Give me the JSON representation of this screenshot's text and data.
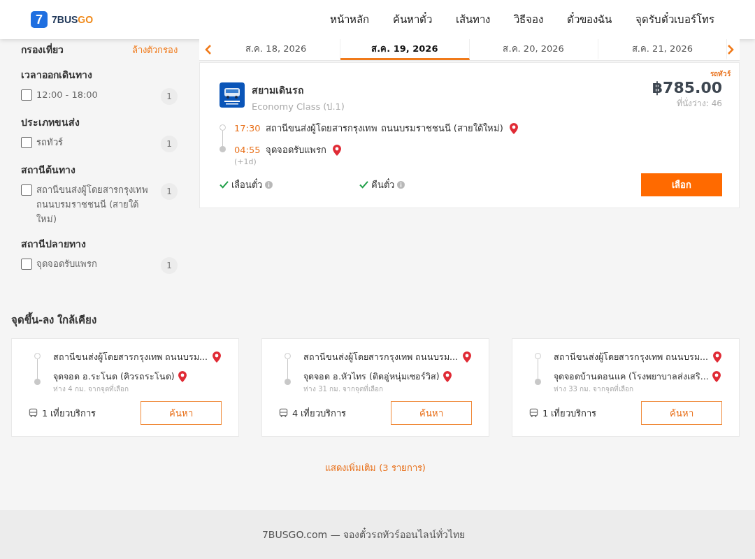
{
  "header": {
    "logo": {
      "mark": "7",
      "brand_dark": "7BUS",
      "brand_accent": "GO"
    },
    "nav": [
      {
        "label": "หน้าหลัก"
      },
      {
        "label": "ค้นหาตั๋ว"
      },
      {
        "label": "เส้นทาง"
      },
      {
        "label": "วิธีจอง"
      },
      {
        "label": "ตั๋วของฉัน"
      },
      {
        "label": "จุดรับตั๋วเบอร์โทร"
      }
    ]
  },
  "filters": {
    "title": "กรองเที่ยว",
    "clear": "ล้างตัวกรอง",
    "groups": [
      {
        "title": "เวลาออกเดินทาง",
        "options": [
          {
            "label": "12:00 - 18:00",
            "count": "1",
            "checked": false
          }
        ]
      },
      {
        "title": "ประเภทขนส่ง",
        "options": [
          {
            "label": "รถทัวร์",
            "count": "1",
            "checked": false
          }
        ]
      },
      {
        "title": "สถานีต้นทาง",
        "options": [
          {
            "label": "สถานีขนส่งผู้โดยสารกรุงเทพ ถนนบรมราชชนนี (สายใต้ใหม่)",
            "count": "1",
            "checked": false
          }
        ]
      },
      {
        "title": "สถานีปลายทาง",
        "options": [
          {
            "label": "จุดจอดรับแพรก",
            "count": "1",
            "checked": false
          }
        ]
      }
    ]
  },
  "date_tabs": [
    {
      "label": "ส.ค. 18, 2026",
      "selected": false
    },
    {
      "label": "ส.ค. 19, 2026",
      "selected": true
    },
    {
      "label": "ส.ค. 20, 2026",
      "selected": false
    },
    {
      "label": "ส.ค. 21, 2026",
      "selected": false
    }
  ],
  "trip": {
    "tag": "รถทัวร์",
    "operator": "สยามเดินรถ",
    "bus_class": "Economy Class (ป.1)",
    "price": "฿785.00",
    "seats": "ที่นั่งว่าง: 46",
    "stops": [
      {
        "time": "17:30",
        "place": "สถานีขนส่งผู้โดยสารกรุงเทพ ถนนบรมราชชนนี (สายใต้ใหม่)",
        "kind": "departure"
      },
      {
        "time": "04:55",
        "place": "จุดจอดรับแพรก",
        "day_offset": "(+1d)",
        "kind": "arrival"
      }
    ],
    "features": [
      {
        "label": "เลื่อนตั๋ว",
        "available": true
      },
      {
        "label": "คืนตั๋ว",
        "available": true
      }
    ],
    "select_button": "เลือก"
  },
  "nearby": {
    "title": "จุดขึ้น-ลง ใกล้เคียง",
    "cards": [
      {
        "from": "สถานีขนส่งผู้โดยสารกรุงเทพ ถนนบรม...",
        "to": "จุดจอด อ.ระโนด (คิวรถระโนด)",
        "distance": "ห่าง 4 กม. จากจุดที่เลือก",
        "trips": "1 เที่ยวบริการ",
        "button": "ค้นหา"
      },
      {
        "from": "สถานีขนส่งผู้โดยสารกรุงเทพ ถนนบรม...",
        "to": "จุดจอด อ.หัวไทร (ติดอู่หนุ่มเซอร์วิส)",
        "distance": "ห่าง 31 กม. จากจุดที่เลือก",
        "trips": "4 เที่ยวบริการ",
        "button": "ค้นหา"
      },
      {
        "from": "สถานีขนส่งผู้โดยสารกรุงเทพ ถนนบรม...",
        "to": "จุดจอดบ้านดอนแค (โรงพยาบาลส่งเสริ...",
        "distance": "ห่าง 33 กม. จากจุดที่เลือก",
        "trips": "1 เที่ยวบริการ",
        "button": "ค้นหา"
      }
    ]
  },
  "show_more": "แสดงเพิ่มเติม (3 รายการ)",
  "footer": "7BUSGO.com — จองตั๋วรถทัวร์ออนไลน์ทั่วไทย"
}
